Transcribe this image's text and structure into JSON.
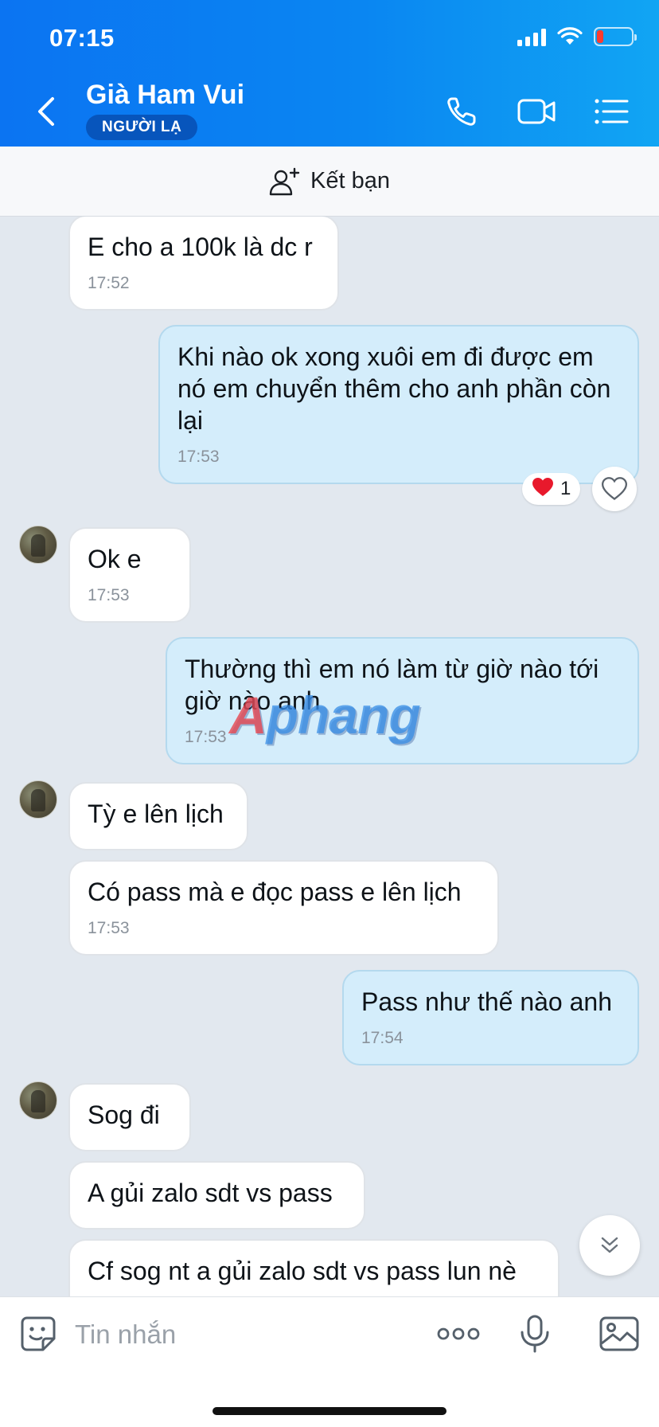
{
  "status_bar": {
    "time": "07:15"
  },
  "header": {
    "contact_name": "Già Ham Vui",
    "badge": "NGƯỜI LẠ"
  },
  "friend_bar": {
    "label": "Kết bạn"
  },
  "messages": [
    {
      "dir": "in",
      "text": "E cho a 100k là dc r",
      "time": "17:52"
    },
    {
      "dir": "out",
      "text": "Khi nào ok xong xuôi em đi được em nó em chuyển thêm cho anh phần còn lại",
      "time": "17:53",
      "reaction": {
        "emoji": "❤️",
        "count": "1"
      }
    },
    {
      "dir": "in",
      "text": "Ok e",
      "time": "17:53"
    },
    {
      "dir": "out",
      "text": "Thường thì em nó làm từ giờ nào tới giờ nào anh",
      "time": "17:53"
    },
    {
      "dir": "in",
      "text": "Tỳ e lên lịch",
      "time": ""
    },
    {
      "dir": "in",
      "text": "Có pass mà e đọc pass e lên lịch",
      "time": "17:53"
    },
    {
      "dir": "out",
      "text": "Pass như thế nào anh",
      "time": "17:54"
    },
    {
      "dir": "in",
      "text": "Sog đi",
      "time": ""
    },
    {
      "dir": "in",
      "text": "A gủi zalo sdt vs pass",
      "time": ""
    },
    {
      "dir": "in",
      "text": "Cf sog nt a gủi zalo sdt vs pass lun nè",
      "time": ""
    }
  ],
  "watermark": {
    "first": "A",
    "rest": "phang"
  },
  "input": {
    "placeholder": "Tin nhắn"
  },
  "colors": {
    "header_start": "#0b74f2",
    "header_end": "#11a5f3",
    "outgoing_bubble": "#d4edfb",
    "incoming_bubble": "#ffffff",
    "badge": "#0755bc"
  }
}
